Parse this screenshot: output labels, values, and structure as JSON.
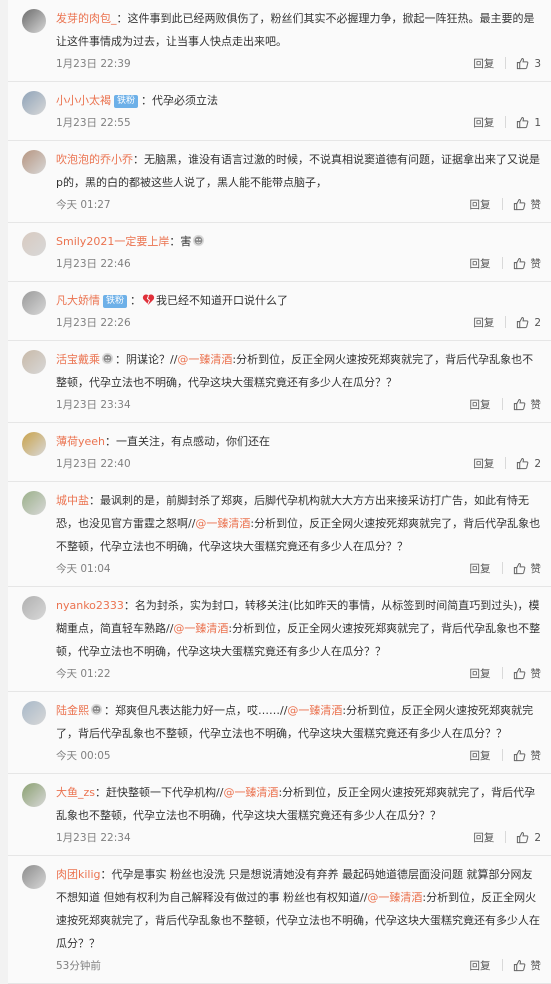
{
  "actions": {
    "reply": "回复"
  },
  "icons": {
    "like": "thumbs-up-icon",
    "broken_heart": "broken-heart-emoji",
    "face": "face-emoji"
  },
  "colors": {
    "nick": "#eb7350",
    "badge": "#6db0e8",
    "text": "#333333",
    "meta": "#808080"
  },
  "comments": [
    {
      "avatar_color": "#6b6b6b",
      "nick": "发芽的肉包_",
      "segments": [
        {
          "t": "text",
          "v": "：这件事到此已经两败俱伤了，粉丝们其实不必握理力争，掀起一阵狂热。最主要的是让这件事情成为过去，让当事人快点走出来吧。"
        }
      ],
      "time": "1月23日 22:39",
      "likes": "3"
    },
    {
      "avatar_color": "#8fa3b8",
      "nick": "小小小太褐",
      "badge": "铁粉",
      "segments": [
        {
          "t": "text",
          "v": "：代孕必须立法"
        }
      ],
      "time": "1月23日 22:55",
      "likes": "1"
    },
    {
      "avatar_color": "#b69580",
      "nick": "吹泡泡的乔小乔",
      "segments": [
        {
          "t": "text",
          "v": "：无脑黑，谁没有语言过激的时候，不说真相说窦道德有问题，证据拿出来了又说是p的，黑的白的都被这些人说了，黑人能不能带点脑子，"
        }
      ],
      "time": "今天 01:27",
      "likes": "赞"
    },
    {
      "avatar_color": "#d8cac0",
      "nick": "Smily2021一定要上岸",
      "segments": [
        {
          "t": "text",
          "v": "：害"
        },
        {
          "t": "emoji",
          "v": "face"
        }
      ],
      "time": "1月23日 22:46",
      "likes": "赞"
    },
    {
      "avatar_color": "#9a9a9a",
      "nick": "凡大娇情",
      "badge": "铁粉",
      "segments": [
        {
          "t": "text",
          "v": "："
        },
        {
          "t": "emoji",
          "v": "broken"
        },
        {
          "t": "text",
          "v": "我已经不知道开口说什么了"
        }
      ],
      "time": "1月23日 22:26",
      "likes": "2"
    },
    {
      "avatar_color": "#c8b9a8",
      "nick": "活宝戴乘",
      "badge_emoji": "face",
      "segments": [
        {
          "t": "text",
          "v": "：阴谋论？//"
        },
        {
          "t": "mention",
          "v": "@一臻清酒"
        },
        {
          "t": "text",
          "v": ":分析到位，反正全网火速按死郑爽就完了，背后代孕乱象也不整顿，代孕立法也不明确，代孕这块大蛋糕究竟还有多少人在瓜分？？"
        }
      ],
      "time": "1月23日 23:34",
      "likes": "赞"
    },
    {
      "avatar_color": "#c9a24a",
      "nick": "薄荷yeeh",
      "segments": [
        {
          "t": "text",
          "v": "：一直关注，有点感动，你们还在"
        }
      ],
      "time": "1月23日 22:40",
      "likes": "2"
    },
    {
      "avatar_color": "#9bb08a",
      "nick": "城中盐",
      "segments": [
        {
          "t": "text",
          "v": "：最讽刺的是，前脚封杀了郑爽，后脚代孕机构就大大方方出来接采访打广告，如此有恃无恐，也没见官方雷霆之怒啊//"
        },
        {
          "t": "mention",
          "v": "@一臻清酒"
        },
        {
          "t": "text",
          "v": ":分析到位，反正全网火速按死郑爽就完了，背后代孕乱象也不整顿，代孕立法也不明确，代孕这块大蛋糕究竟还有多少人在瓜分？？"
        }
      ],
      "time": "今天 01:04",
      "likes": "赞"
    },
    {
      "avatar_color": "#b0b0b0",
      "nick": "nyanko2333",
      "segments": [
        {
          "t": "text",
          "v": "：名为封杀，实为封口，转移关注(比如昨天的事情，从标签到时间简直巧到过头)，模糊重点，简直轻车熟路//"
        },
        {
          "t": "mention",
          "v": "@一臻清酒"
        },
        {
          "t": "text",
          "v": ":分析到位，反正全网火速按死郑爽就完了，背后代孕乱象也不整顿，代孕立法也不明确，代孕这块大蛋糕究竟还有多少人在瓜分？？"
        }
      ],
      "time": "今天 01:22",
      "likes": "赞"
    },
    {
      "avatar_color": "#a8b8c8",
      "nick": "陆金熙",
      "badge_emoji": "face",
      "segments": [
        {
          "t": "text",
          "v": "：郑爽但凡表达能力好一点，哎……//"
        },
        {
          "t": "mention",
          "v": "@一臻清酒"
        },
        {
          "t": "text",
          "v": ":分析到位，反正全网火速按死郑爽就完了，背后代孕乱象也不整顿，代孕立法也不明确，代孕这块大蛋糕究竟还有多少人在瓜分？？"
        }
      ],
      "time": "今天 00:05",
      "likes": "赞"
    },
    {
      "avatar_color": "#8aa070",
      "nick": "大鱼_zs",
      "segments": [
        {
          "t": "text",
          "v": "：赶快整顿一下代孕机构//"
        },
        {
          "t": "mention",
          "v": "@一臻清酒"
        },
        {
          "t": "text",
          "v": ":分析到位，反正全网火速按死郑爽就完了，背后代孕乱象也不整顿，代孕立法也不明确，代孕这块大蛋糕究竟还有多少人在瓜分？？"
        }
      ],
      "time": "1月23日 22:34",
      "likes": "2"
    },
    {
      "avatar_color": "#8c8c8c",
      "nick": "肉团kilig",
      "segments": [
        {
          "t": "text",
          "v": "：代孕是事实 粉丝也没洗 只是想说清她没有弃养 最起码她道德层面没问题 就算部分网友不想知道 但她有权利为自己解释没有做过的事 粉丝也有权知道//"
        },
        {
          "t": "mention",
          "v": "@一臻清酒"
        },
        {
          "t": "text",
          "v": ":分析到位，反正全网火速按死郑爽就完了，背后代孕乱象也不整顿，代孕立法也不明确，代孕这块大蛋糕究竟还有多少人在瓜分？？"
        }
      ],
      "time": "53分钟前",
      "likes": "赞"
    }
  ]
}
